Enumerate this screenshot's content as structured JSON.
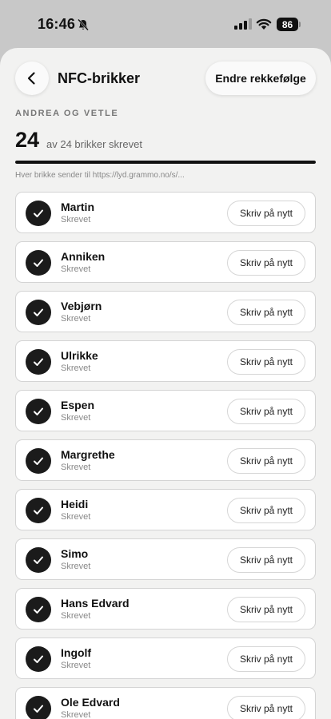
{
  "status_bar": {
    "time": "16:46",
    "battery": "86",
    "icons": [
      "bell-slash-icon",
      "signal-icon",
      "wifi-icon",
      "battery-icon"
    ]
  },
  "header": {
    "title": "NFC-brikker",
    "back_icon": "chevron-left-icon",
    "reorder_label": "Endre rekkefølge"
  },
  "summary": {
    "group_label": "ANDREA OG VETLE",
    "written_count": "24",
    "count_text": "av 24 brikker skrevet",
    "progress": 1.0,
    "url_note": "Hver brikke sender til https://lyd.grammo.no/s/..."
  },
  "tags": [
    {
      "name": "Martin",
      "status": "Skrevet",
      "action": "Skriv på nytt"
    },
    {
      "name": "Anniken",
      "status": "Skrevet",
      "action": "Skriv på nytt"
    },
    {
      "name": "Vebjørn",
      "status": "Skrevet",
      "action": "Skriv på nytt"
    },
    {
      "name": "Ulrikke",
      "status": "Skrevet",
      "action": "Skriv på nytt"
    },
    {
      "name": "Espen",
      "status": "Skrevet",
      "action": "Skriv på nytt"
    },
    {
      "name": "Margrethe",
      "status": "Skrevet",
      "action": "Skriv på nytt"
    },
    {
      "name": "Heidi",
      "status": "Skrevet",
      "action": "Skriv på nytt"
    },
    {
      "name": "Simo",
      "status": "Skrevet",
      "action": "Skriv på nytt"
    },
    {
      "name": "Hans Edvard",
      "status": "Skrevet",
      "action": "Skriv på nytt"
    },
    {
      "name": "Ingolf",
      "status": "Skrevet",
      "action": "Skriv på nytt"
    },
    {
      "name": "Ole Edvard",
      "status": "Skrevet",
      "action": "Skriv på nytt"
    }
  ],
  "colors": {
    "accent": "#111111",
    "background": "#f2f2f1",
    "card": "#ffffff"
  }
}
